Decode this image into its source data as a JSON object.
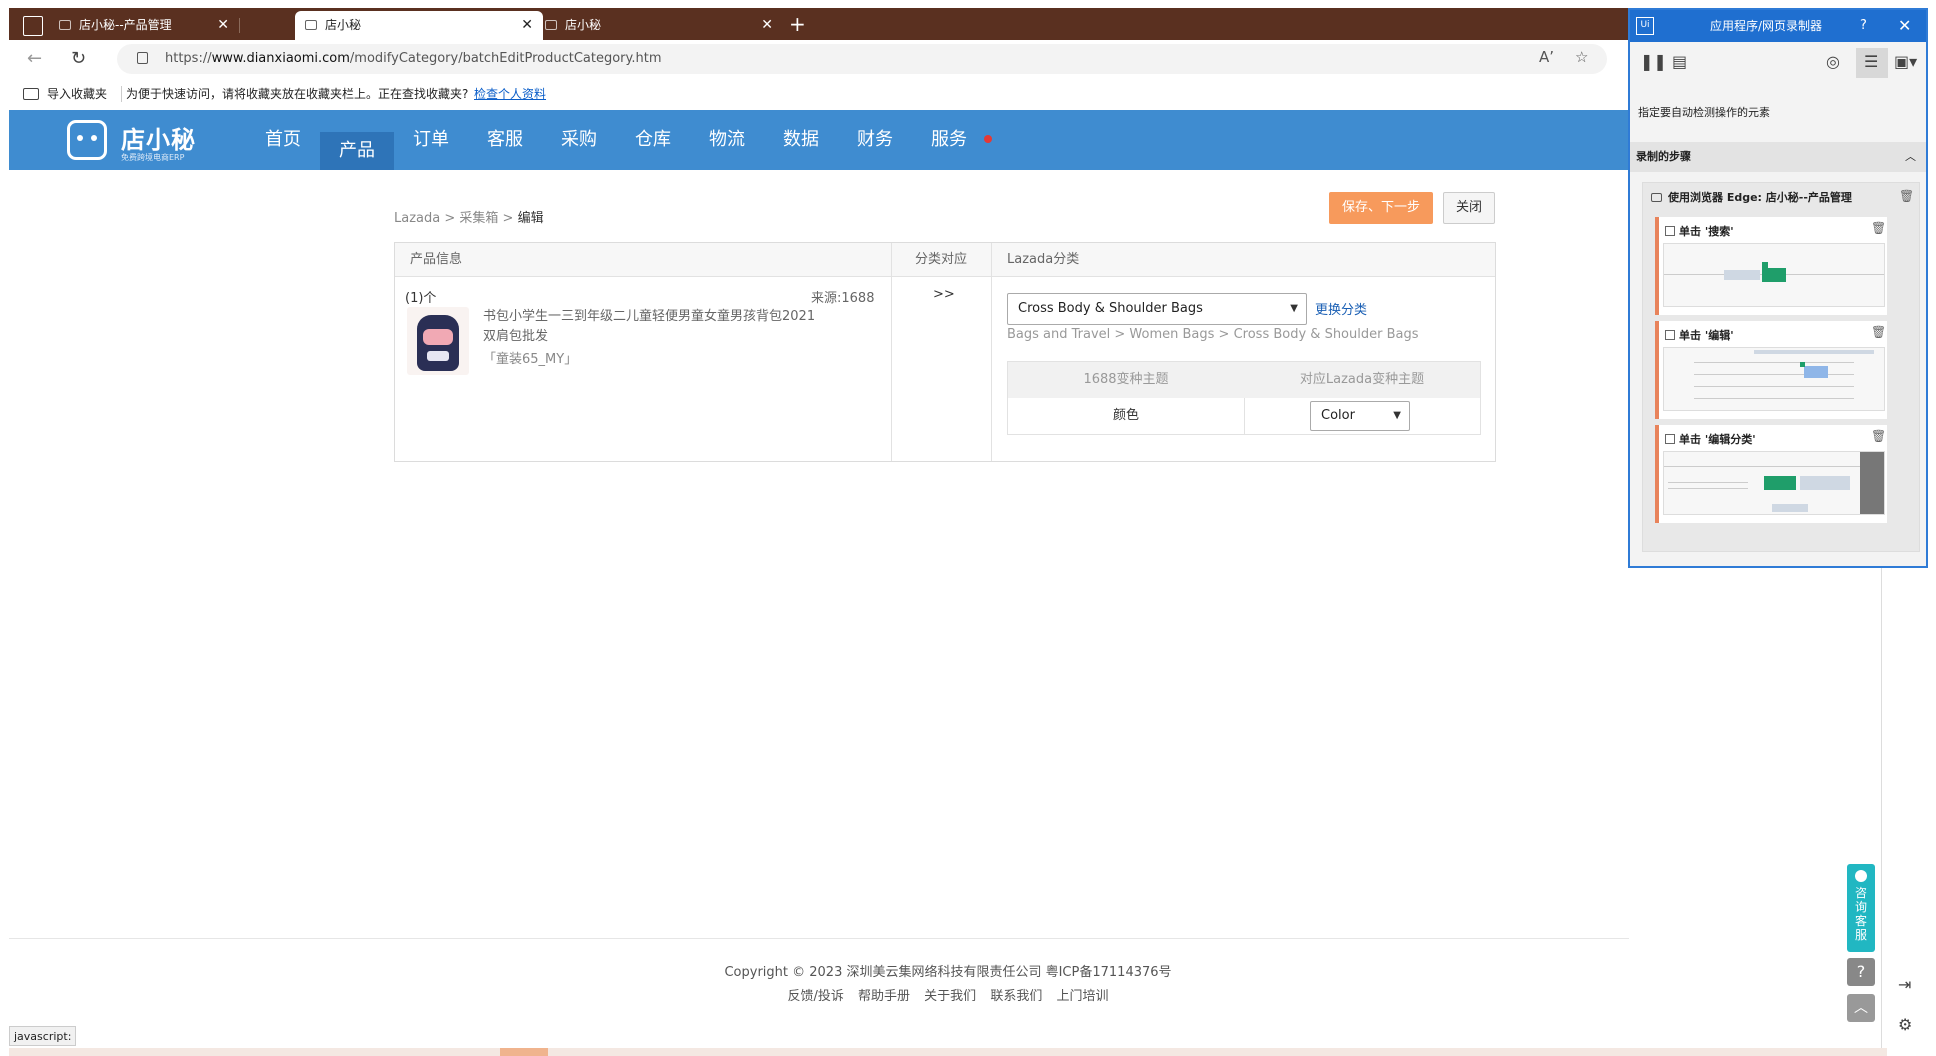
{
  "browser": {
    "tabs": [
      {
        "title": "店小秘--产品管理",
        "active": false
      },
      {
        "title": "店小秘",
        "active": true
      },
      {
        "title": "店小秘",
        "active": false
      }
    ],
    "url_prefix": "https://",
    "url_host": "www.dianxiaomi.com",
    "url_path": "/modifyCategory/batchEditProductCategory.htm",
    "favorites": {
      "import_label": "导入收藏夹",
      "hint": "为便于快速访问，请将收藏夹放在收藏夹栏上。正在查找收藏夹?",
      "link": "检查个人资料"
    },
    "status_tip": "javascript:"
  },
  "app": {
    "logo_title": "店小秘",
    "logo_sub": "免费跨境电商ERP",
    "nav": [
      "首页",
      "产品",
      "订单",
      "客服",
      "采购",
      "仓库",
      "物流",
      "数据",
      "财务",
      "服务"
    ],
    "active_nav": "产品"
  },
  "page": {
    "save_label": "保存、下一步",
    "close_label": "关闭",
    "breadcrumb": [
      "Lazada",
      "采集箱",
      "编辑"
    ],
    "headers": {
      "product_info": "产品信息",
      "mapping": "分类对应",
      "lazada_category": "Lazada分类"
    },
    "product": {
      "count": "(1)个",
      "source": "来源:1688",
      "title": "书包小学生一三到年级二儿童轻便男童女童男孩背包2021双肩包批发",
      "sku": "「童装65_MY」"
    },
    "arrow": ">>",
    "category": {
      "selected": "Cross Body & Shoulder Bags",
      "change_link": "更换分类",
      "path": "Bags and Travel > Women Bags > Cross Body & Shoulder Bags"
    },
    "variant_table": {
      "col1": "1688变种主题",
      "col2": "对应Lazada变种主题",
      "rows": [
        {
          "source": "颜色",
          "target": "Color"
        }
      ]
    }
  },
  "footer": {
    "copyright": "Copyright © 2023 深圳美云集网络科技有限责任公司  粤ICP备17114376号",
    "links": [
      "反馈/投诉",
      "帮助手册",
      "关于我们",
      "联系我们",
      "上门培训"
    ]
  },
  "widgets": {
    "consult": "咨询客服"
  },
  "recorder": {
    "title": "应用程序/网页录制器",
    "help": "?",
    "hint": "指定要自动检测操作的元素",
    "section": "录制的步骤",
    "browser_step": "使用浏览器 Edge: 店小秘--产品管理",
    "steps": [
      "单击 '搜索'",
      "单击 '编辑'",
      "单击 '编辑分类'"
    ]
  }
}
